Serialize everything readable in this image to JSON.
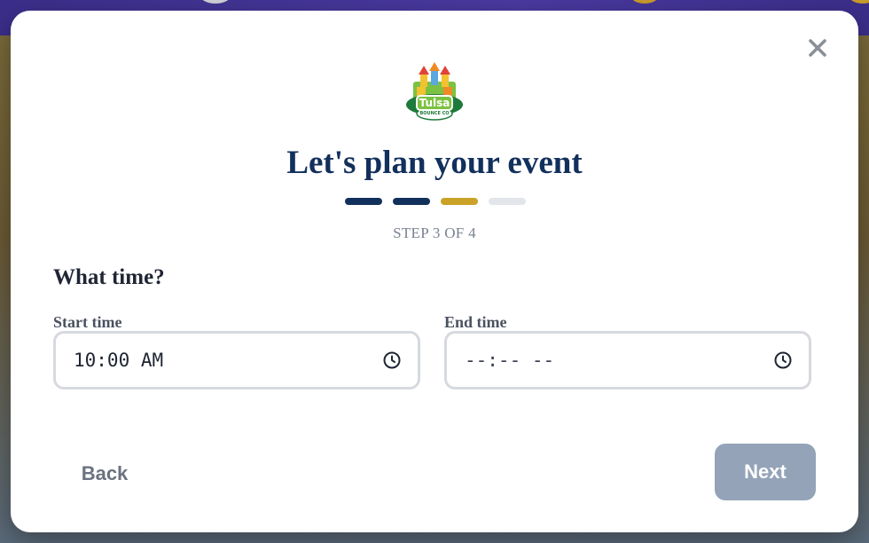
{
  "modal": {
    "title": "Let's plan your event",
    "step_label": "STEP 3 OF 4",
    "progress": {
      "total_steps": 4,
      "current_step": 3,
      "colors": {
        "completed": "#12305c",
        "current": "#c9a227",
        "upcoming": "#e2e5ea"
      }
    },
    "section_title": "What time?",
    "start_time": {
      "label": "Start time",
      "value": "10:00 AM",
      "icon": "clock-icon"
    },
    "end_time": {
      "label": "End time",
      "value": "--:-- --",
      "icon": "clock-icon"
    },
    "footer": {
      "back_label": "Back",
      "next_label": "Next"
    },
    "close_icon": "close-icon",
    "logo": {
      "icon": "bounce-castle-logo",
      "wordmark": "Tulsa",
      "sub": "BOUNCE CO"
    }
  },
  "colors": {
    "brand_navy": "#12305c",
    "accent_gold": "#c9a227",
    "disabled_button": "#94a3b8"
  }
}
